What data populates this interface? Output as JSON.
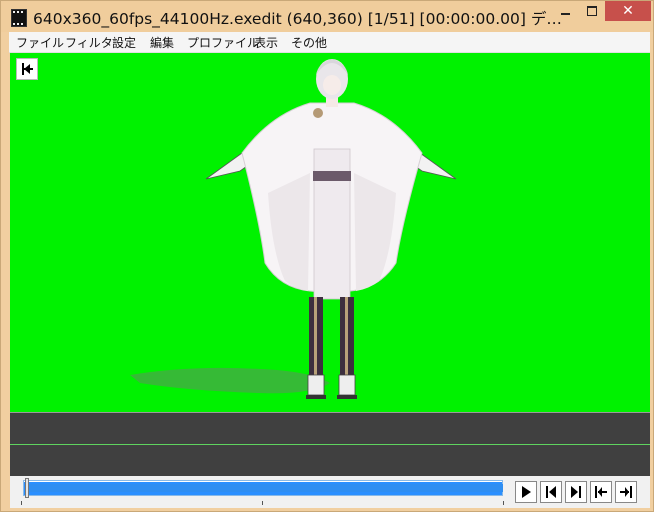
{
  "window": {
    "title": "640x360_60fps_44100Hz.exedit (640,360)  [1/51] [00:00:00.00]  デ…",
    "min_symbol": "",
    "max_symbol": "",
    "close_symbol": "✕"
  },
  "menu": {
    "items": [
      {
        "label": "ファイル"
      },
      {
        "label": "フィルタ"
      },
      {
        "label": "設定"
      },
      {
        "label": "編集"
      },
      {
        "label": "プロファイル"
      },
      {
        "label": "表示"
      },
      {
        "label": "その他"
      }
    ]
  },
  "playback": {
    "current_frame": 1,
    "total_frames": 51,
    "position_fraction": 0.0
  },
  "colors": {
    "background": "#00f200",
    "timeline": "#404040",
    "seek": "#2b8fff",
    "title_bar": "#f0cd9c",
    "close_button": "#c7504b"
  },
  "icons": {
    "back_to_start": "skip-to-start-icon",
    "play": "play-icon",
    "prev_frame": "previous-frame-icon",
    "next_frame": "next-frame-icon",
    "first_frame": "first-frame-icon",
    "last_frame": "last-frame-icon"
  }
}
